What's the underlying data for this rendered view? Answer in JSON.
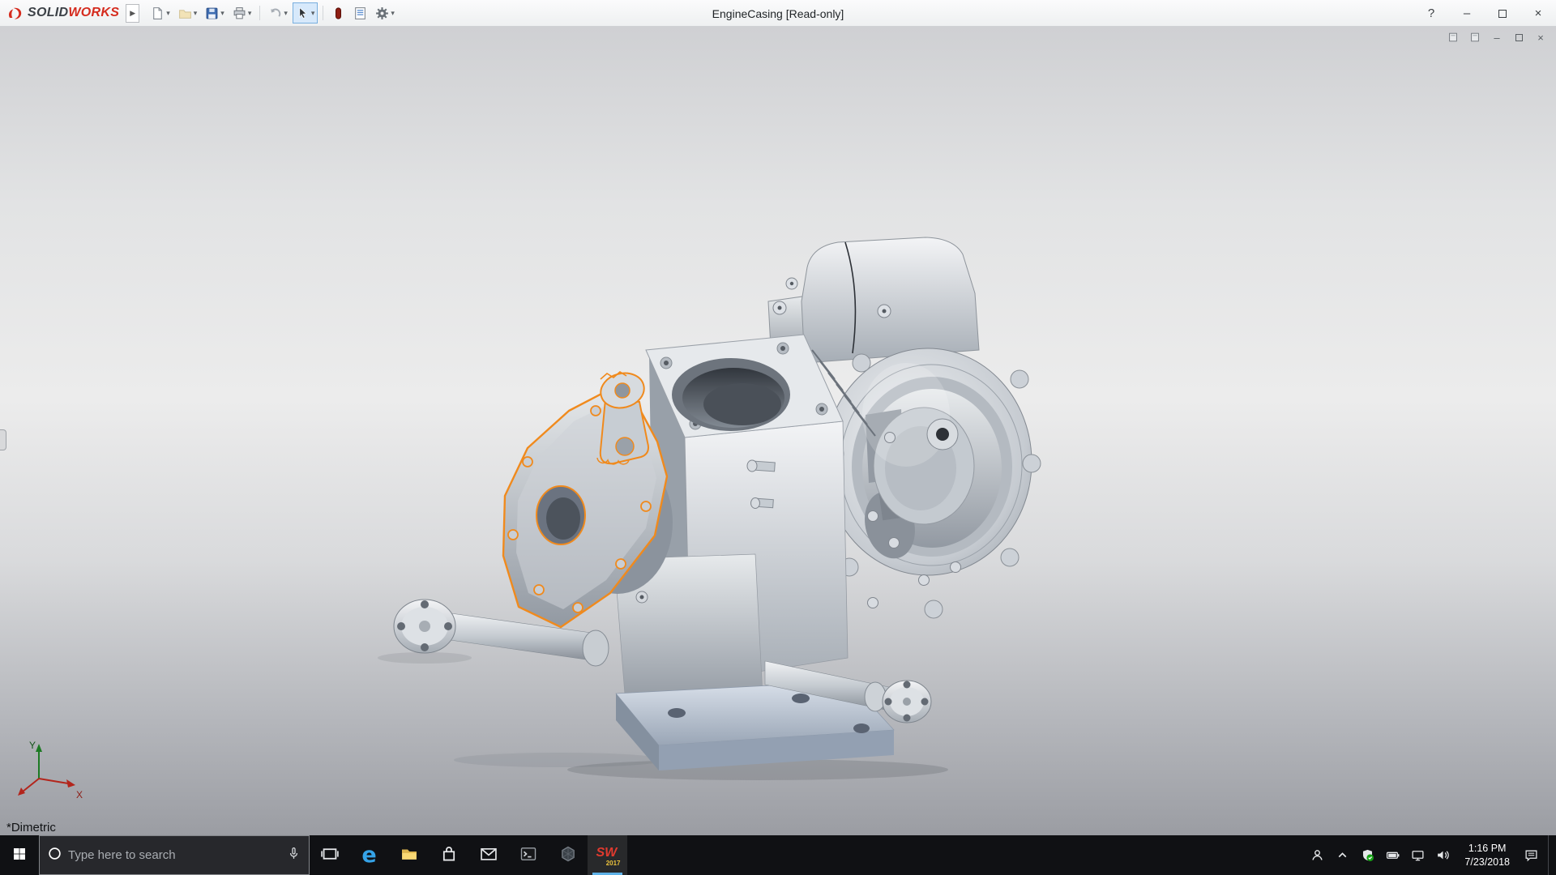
{
  "glyphs": {
    "flyout_arrow": "▶",
    "caret": "▾",
    "help": "?",
    "minimize": "–",
    "close": "×",
    "edge_letter": "e"
  },
  "titlebar": {
    "brand_solid": "SOLID",
    "brand_works": "WORKS",
    "document_title": "EngineCasing [Read-only]",
    "toolbar_icons": [
      "new-document",
      "open-document",
      "save",
      "print",
      "undo",
      "select",
      "rebuild",
      "file-properties",
      "options"
    ]
  },
  "viewport": {
    "view_orientation": "*Dimetric",
    "triad": {
      "x_label": "X",
      "y_label": "Y"
    },
    "selection_color": "#f08a1d"
  },
  "taskbar": {
    "search_placeholder": "Type here to search",
    "pinned_apps": [
      "task-view",
      "edge",
      "file-explorer",
      "store",
      "mail",
      "command-prompt",
      "cad-viewer",
      "solidworks-2017"
    ],
    "active_app": "solidworks-2017",
    "solidworks_icon": {
      "label": "SW",
      "year": "2017"
    },
    "tray_time": "1:16 PM",
    "tray_date": "7/23/2018"
  },
  "colors": {
    "brand_red": "#d52b1e",
    "selection_orange": "#f08a1d",
    "taskbar_bg": "#101114",
    "active_app_underline": "#5fb2e8"
  }
}
